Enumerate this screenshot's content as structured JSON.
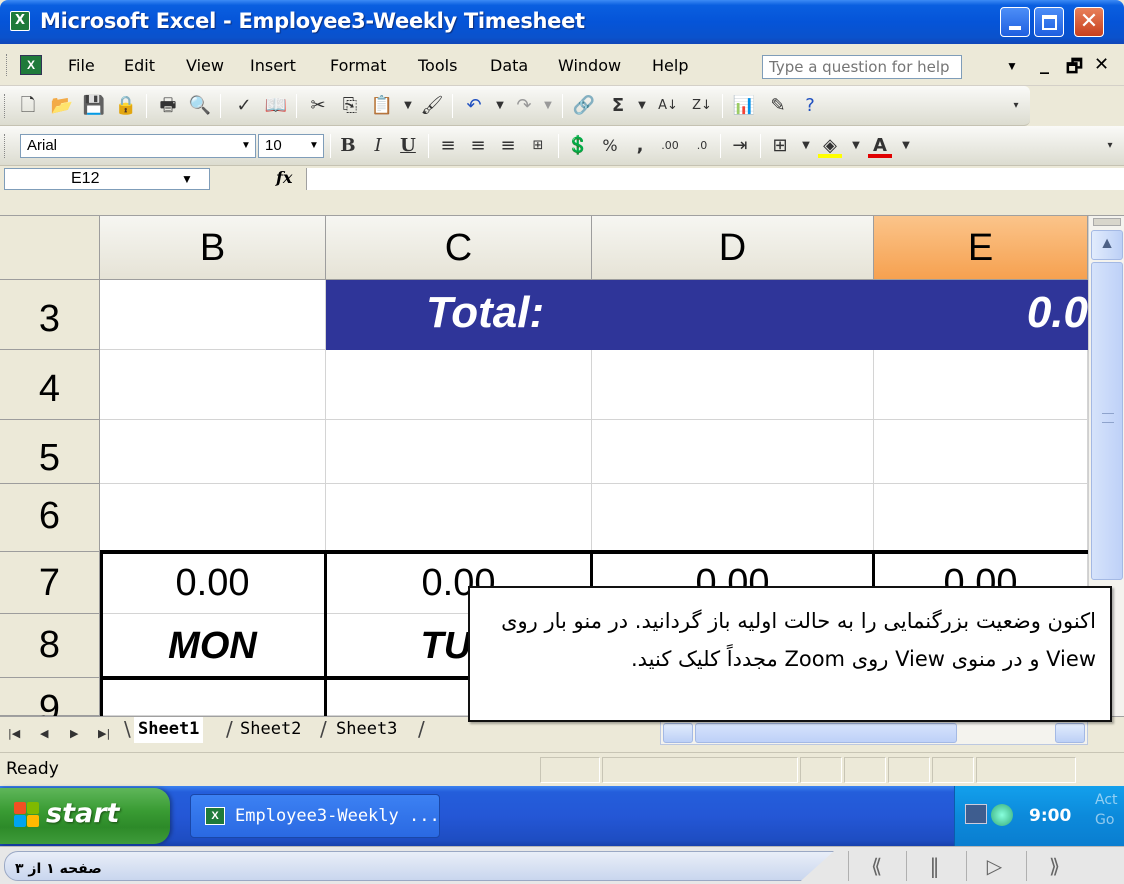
{
  "window": {
    "title": "Microsoft Excel - Employee3-Weekly Timesheet",
    "icon": "excel-icon"
  },
  "menu": {
    "items": [
      "File",
      "Edit",
      "View",
      "Insert",
      "Format",
      "Tools",
      "Data",
      "Window",
      "Help"
    ],
    "help_placeholder": "Type a question for help"
  },
  "format_toolbar": {
    "font": "Arial",
    "size": "10"
  },
  "formula_bar": {
    "name_box": "E12",
    "fx_label": "fx",
    "value": ""
  },
  "grid": {
    "columns": [
      "B",
      "C",
      "D",
      "E"
    ],
    "active_column": "E",
    "rows": [
      "3",
      "4",
      "5",
      "6",
      "7",
      "8",
      "9"
    ],
    "total_label": "Total:",
    "total_value": "0.0",
    "row7": [
      "0.00",
      "0.00",
      "0.00",
      "0.00"
    ],
    "row8": [
      "MON",
      "TUE"
    ],
    "header_color": "#2f3599"
  },
  "sheets": {
    "tabs": [
      "Sheet1",
      "Sheet2",
      "Sheet3"
    ],
    "active": "Sheet1"
  },
  "status": {
    "text": "Ready"
  },
  "taskbar": {
    "start_label": "start",
    "task_label": "Employee3-Weekly ...",
    "clock": "9:00",
    "watermark": "Act\nGo"
  },
  "callout": {
    "text": "اکنون وضعیت بزرگنمایی را به حالت اولیه باز گردانید. در منو بار روی View و در منوی View روی Zoom مجدداً کلیک کنید."
  },
  "footer": {
    "page_label": "صفحه ۱ از ۳",
    "nav": [
      "⟪",
      "‖",
      "▷",
      "⟫"
    ]
  }
}
